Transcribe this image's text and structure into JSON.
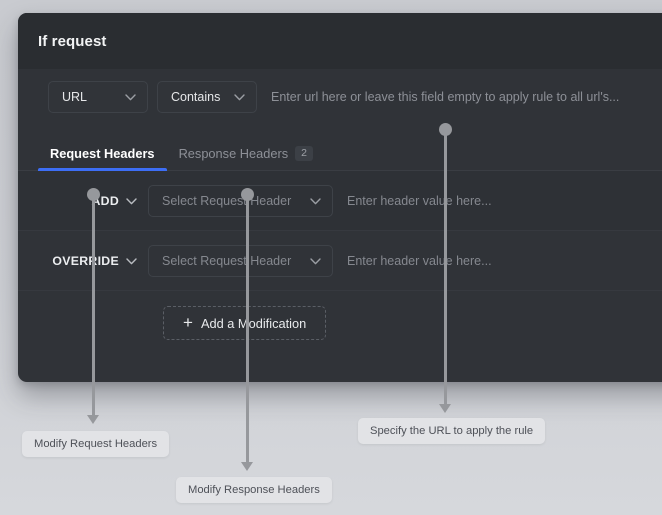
{
  "card": {
    "title": "If request",
    "condition": {
      "url_kind": {
        "value": "URL",
        "icon": "chevron-down-icon"
      },
      "match_kind": {
        "value": "Contains",
        "icon": "chevron-down-icon"
      },
      "url_input": {
        "value": "",
        "placeholder": "Enter url here or leave this field empty to apply rule to all url's..."
      }
    },
    "tabs": [
      {
        "label": "Request Headers",
        "badge": "",
        "active": true
      },
      {
        "label": "Response Headers",
        "badge": "2",
        "active": false
      }
    ],
    "modifications": [
      {
        "action": "ADD",
        "action_icon": "chevron-down-icon",
        "header_select": {
          "value": "",
          "placeholder": "Select Request Header",
          "icon": "chevron-down-icon"
        },
        "value_input": {
          "value": "",
          "placeholder": "Enter header value here..."
        }
      },
      {
        "action": "OVERRIDE",
        "action_icon": "chevron-down-icon",
        "header_select": {
          "value": "",
          "placeholder": "Select Request Header",
          "icon": "chevron-down-icon"
        },
        "value_input": {
          "value": "",
          "placeholder": "Enter header value here..."
        }
      }
    ],
    "add_button": {
      "label": "Add a Modification",
      "icon": "plus-icon",
      "plus": "+"
    }
  },
  "annotations": [
    {
      "id": "request-headers",
      "label": "Modify Request Headers"
    },
    {
      "id": "response-headers",
      "label": "Modify Response Headers"
    },
    {
      "id": "url-rule",
      "label": "Specify the URL to apply the rule"
    }
  ],
  "colors": {
    "card_bg": "#303338",
    "card_header_bg": "#2a2d31",
    "accent": "#3d6ef5",
    "page_bg": "#cdcfd4",
    "pointer": "#96989c",
    "callout_bg": "#e2e3e6"
  }
}
